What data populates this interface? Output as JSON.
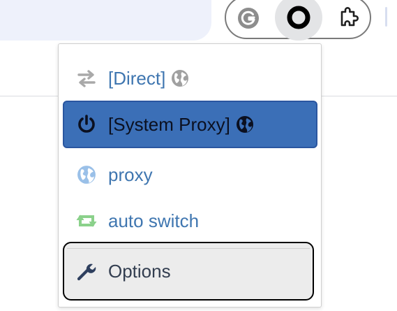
{
  "toolbar": {
    "extensions": [
      {
        "name": "Grammarly",
        "icon": "grammarly-icon",
        "active": false
      },
      {
        "name": "Proxy SwitchyOmega",
        "icon": "omega-icon",
        "active": true
      },
      {
        "name": "Extensions",
        "icon": "puzzle-icon",
        "active": false
      }
    ]
  },
  "menu": {
    "items": [
      {
        "label": "[Direct]",
        "icon": "transfer-arrows-icon",
        "globe": true,
        "selected": false
      },
      {
        "label": "[System Proxy]",
        "icon": "power-icon",
        "globe": true,
        "selected": true
      },
      {
        "label": "proxy",
        "icon": "globe-icon",
        "globe": false,
        "selected": false
      },
      {
        "label": "auto switch",
        "icon": "retweet-icon",
        "globe": false,
        "selected": false
      },
      {
        "label": "Options",
        "icon": "wrench-icon",
        "globe": false,
        "selected": false
      }
    ]
  },
  "colors": {
    "selected_bg": "#3b6fb7",
    "link_text": "#3f76b0",
    "auto_switch_icon": "#8bd18b",
    "globe_light": "#9ac0e8"
  }
}
